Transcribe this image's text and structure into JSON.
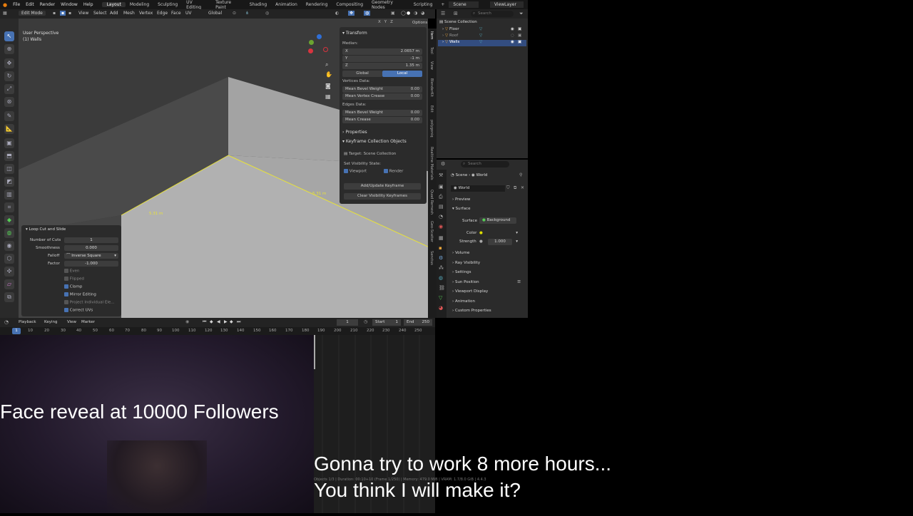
{
  "topbar": {
    "menus": [
      "File",
      "Edit",
      "Render",
      "Window",
      "Help"
    ],
    "workspaces": [
      "Layout",
      "Modeling",
      "Sculpting",
      "UV Editing",
      "Texture Paint",
      "Shading",
      "Animation",
      "Rendering",
      "Compositing",
      "Geometry Nodes",
      "Scripting"
    ],
    "active_workspace": "Layout",
    "scene": "Scene",
    "view_layer": "ViewLayer"
  },
  "header": {
    "mode": "Edit Mode",
    "menus": [
      "View",
      "Select",
      "Add",
      "Mesh",
      "Vertex",
      "Edge",
      "Face",
      "UV"
    ],
    "orientation": "Global",
    "options": "Options",
    "axes": [
      "X",
      "Y",
      "Z"
    ]
  },
  "viewport": {
    "perspective": "User Perspective",
    "object": "(1) Walls",
    "measure_1": "5.31 m",
    "measure_2": "5.31 m"
  },
  "npanel": {
    "transform_title": "Transform",
    "median_label": "Median:",
    "x_label": "X",
    "x_value": "2.0657 m",
    "y_label": "Y",
    "y_value": "-1 m",
    "z_label": "Z",
    "z_value": "1.35 m",
    "global_btn": "Global",
    "local_btn": "Local",
    "vertices_data": "Vertices Data:",
    "mean_bevel_weight_v": "Mean Bevel Weight",
    "mean_bevel_weight_v_val": "0.00",
    "mean_vertex_crease": "Mean Vertex Crease",
    "mean_vertex_crease_val": "0.00",
    "edges_data": "Edges Data:",
    "mean_bevel_weight_e": "Mean Bevel Weight",
    "mean_bevel_weight_e_val": "0.00",
    "mean_crease": "Mean Crease",
    "mean_crease_val": "0.00",
    "properties_title": "Properties",
    "keyframe_title": "Keyframe Collection Objects",
    "target": "Target: Scene Collection",
    "visibility_state": "Set Visibility State:",
    "viewport_cb": "Viewport",
    "render_cb": "Render",
    "add_update_btn": "Add/Update Keyframe",
    "clear_btn": "Clear Visibility Keyframes"
  },
  "vtabs": [
    "Item",
    "Tool",
    "View",
    "BlenderKit",
    "Edit",
    "polygoniq",
    "Realtime Materials",
    "Quad Remesh",
    "Geo-Scatter",
    "Sanctus"
  ],
  "operator": {
    "title": "Loop Cut and Slide",
    "number_of_cuts_label": "Number of Cuts",
    "number_of_cuts": "1",
    "smoothness_label": "Smoothness",
    "smoothness": "0.000",
    "falloff_label": "Falloff",
    "falloff": "Inverse Square",
    "factor_label": "Factor",
    "factor": "-1.000",
    "even": "Even",
    "flipped": "Flipped",
    "clamp": "Clamp",
    "mirror_editing": "Mirror Editing",
    "project_individual": "Project Individual Ele...",
    "correct_uvs": "Correct UVs"
  },
  "outliner": {
    "search_placeholder": "Search",
    "root": "Scene Collection",
    "items": [
      "Floor",
      "Roof",
      "Walls"
    ]
  },
  "properties": {
    "search_placeholder": "Search",
    "breadcrumb_scene": "Scene",
    "breadcrumb_world": "World",
    "world_name": "World",
    "preview": "Preview",
    "surface": "Surface",
    "surface_label": "Surface",
    "surface_value": "Background",
    "color_label": "Color",
    "strength_label": "Strength",
    "strength_value": "1.000",
    "volume": "Volume",
    "ray_visibility": "Ray Visibility",
    "settings": "Settings",
    "sun_position": "Sun Position",
    "viewport_display": "Viewport Display",
    "animation": "Animation",
    "custom_properties": "Custom Properties"
  },
  "timeline": {
    "playback": "Playback",
    "keying": "Keying",
    "view": "View",
    "marker": "Marker",
    "current_frame": "1",
    "start_label": "Start",
    "start": "1",
    "end_label": "End",
    "end": "250",
    "ticks": [
      "10",
      "20",
      "30",
      "40",
      "50",
      "60",
      "70",
      "80",
      "90",
      "100",
      "110",
      "120",
      "130",
      "140",
      "150",
      "160",
      "170",
      "180",
      "190",
      "200",
      "210",
      "220",
      "230",
      "240",
      "250"
    ],
    "playhead": "1"
  },
  "status": "Objects 1/3 | Duration: 00:10+10 (Frame 1/250) | Memory: 479.0 MiB | VRAM: 1.7/8.0 GiB | 4.4.3",
  "overlay": {
    "face_reveal": "Face reveal at 10000 Followers",
    "line1": "Gonna try to work 8 more hours...",
    "line2": "You think I will make it?"
  },
  "colors": {
    "accent": "#4772b3",
    "selected_edge": "#e8e23a",
    "header": "#232323"
  }
}
